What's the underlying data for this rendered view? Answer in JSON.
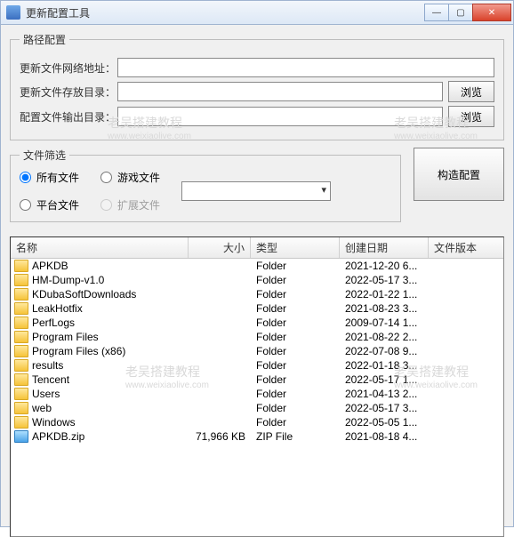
{
  "window": {
    "title": "更新配置工具",
    "min": "—",
    "max": "▢",
    "close": "✕"
  },
  "path_group": {
    "legend": "路径配置",
    "net_label": "更新文件网络地址：",
    "net_value": "",
    "store_label": "更新文件存放目录：",
    "store_value": "",
    "out_label": "配置文件输出目录：",
    "out_value": "",
    "browse": "浏览"
  },
  "filter_group": {
    "legend": "文件筛选",
    "all": "所有文件",
    "game": "游戏文件",
    "platform": "平台文件",
    "ext": "扩展文件",
    "build_btn": "构造配置"
  },
  "columns": {
    "name": "名称",
    "size": "大小",
    "type": "类型",
    "date": "创建日期",
    "ver": "文件版本"
  },
  "files": [
    {
      "name": "APKDB",
      "size": "",
      "type": "Folder",
      "date": "2021-12-20 6...",
      "icon": "folder"
    },
    {
      "name": "HM-Dump-v1.0",
      "size": "",
      "type": "Folder",
      "date": "2022-05-17 3...",
      "icon": "folder"
    },
    {
      "name": "KDubaSoftDownloads",
      "size": "",
      "type": "Folder",
      "date": "2022-01-22 1...",
      "icon": "folder"
    },
    {
      "name": "LeakHotfix",
      "size": "",
      "type": "Folder",
      "date": "2021-08-23 3...",
      "icon": "folder"
    },
    {
      "name": "PerfLogs",
      "size": "",
      "type": "Folder",
      "date": "2009-07-14 1...",
      "icon": "folder"
    },
    {
      "name": "Program Files",
      "size": "",
      "type": "Folder",
      "date": "2021-08-22 2...",
      "icon": "folder"
    },
    {
      "name": "Program Files (x86)",
      "size": "",
      "type": "Folder",
      "date": "2022-07-08 9...",
      "icon": "folder"
    },
    {
      "name": "results",
      "size": "",
      "type": "Folder",
      "date": "2022-01-18 3...",
      "icon": "folder"
    },
    {
      "name": "Tencent",
      "size": "",
      "type": "Folder",
      "date": "2022-05-17 1...",
      "icon": "folder"
    },
    {
      "name": "Users",
      "size": "",
      "type": "Folder",
      "date": "2021-04-13 2...",
      "icon": "folder"
    },
    {
      "name": "web",
      "size": "",
      "type": "Folder",
      "date": "2022-05-17 3...",
      "icon": "folder"
    },
    {
      "name": "Windows",
      "size": "",
      "type": "Folder",
      "date": "2022-05-05 1...",
      "icon": "folder"
    },
    {
      "name": "APKDB.zip",
      "size": "71,966 KB",
      "type": "ZIP File",
      "date": "2021-08-18 4...",
      "icon": "zip"
    }
  ],
  "watermark": {
    "line1": "老吴搭建教程",
    "line2": "www.weixiaolive.com"
  }
}
